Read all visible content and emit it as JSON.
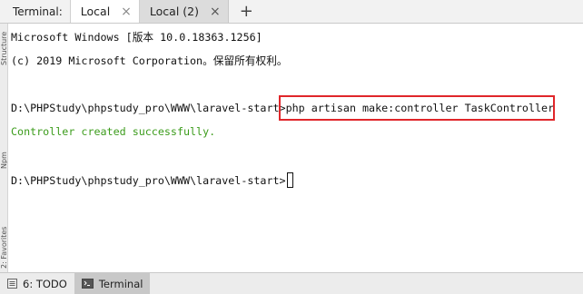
{
  "tabbar": {
    "title": "Terminal:",
    "tabs": [
      {
        "label": "Local",
        "close": "×",
        "active": true
      },
      {
        "label": "Local (2)",
        "close": "×",
        "active": false
      }
    ],
    "add_label": "+"
  },
  "left_strip": {
    "label_top": "Npm",
    "label_bottom": "2: Favorites",
    "label_mid": "Structure"
  },
  "terminal": {
    "lines": [
      "Microsoft Windows [版本 10.0.18363.1256]",
      "(c) 2019 Microsoft Corporation。保留所有权利。",
      "D:\\PHPStudy\\phpstudy_pro\\WWW\\laravel-start>",
      "php artisan make:controller TaskController",
      "Controller created successfully.",
      "D:\\PHPStudy\\phpstudy_pro\\WWW\\laravel-start>"
    ],
    "success_color": "#3c9c1c",
    "highlight_color": "#e0262a"
  },
  "bottombar": {
    "todo_label": "6: TODO",
    "terminal_label": "Terminal",
    "icons": [
      "todo-list-icon",
      "terminal-icon"
    ]
  }
}
